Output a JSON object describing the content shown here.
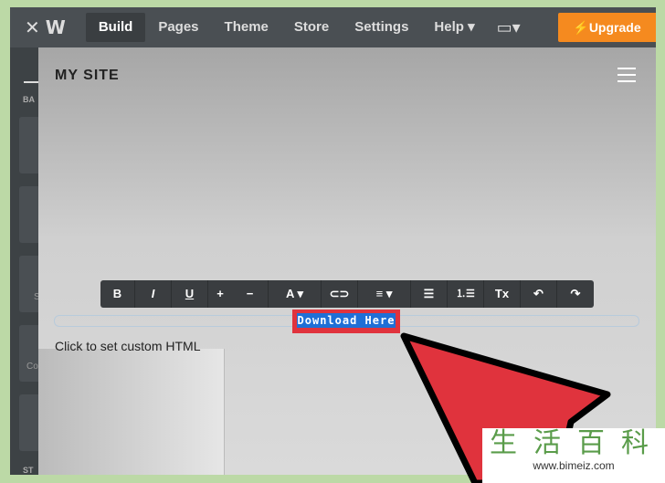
{
  "topbar": {
    "close_icon": "close-icon",
    "logo_icon": "weebly-logo",
    "tabs": [
      "Build",
      "Pages",
      "Theme",
      "Store",
      "Settings",
      "Help ▾"
    ],
    "device_icon": "desktop-icon",
    "upgrade": "⚡Upgrade"
  },
  "sidebar": {
    "labels": [
      "BA",
      "S",
      "Co",
      "ST"
    ]
  },
  "site": {
    "title": "MY SITE",
    "menu_icon": "hamburger-icon"
  },
  "toolbar": {
    "tools": [
      "B",
      "I",
      "U",
      "+",
      "−",
      "A ▾",
      "⊂⊃",
      "≡ ▾",
      "☰",
      "⒈☰",
      "Tx",
      "↶",
      "↷"
    ]
  },
  "editor": {
    "selected_text": "Download Here",
    "custom_html": "Click to set custom HTML"
  },
  "watermark": {
    "cn": "生活百科",
    "url": "www.bimeiz.com"
  },
  "colors": {
    "accent": "#f58a1f",
    "highlight": "#e0333d",
    "selection": "#1f6fd6"
  }
}
